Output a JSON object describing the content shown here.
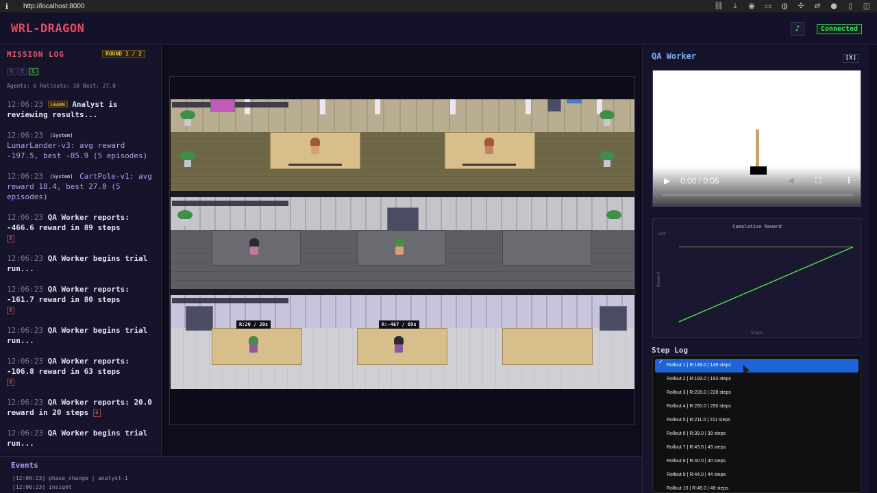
{
  "browser": {
    "url": "http://localhost:8000"
  },
  "header": {
    "title": "WRL-DRAGON",
    "music_icon": "♪",
    "status": "Connected",
    "status_color": "#4be06a"
  },
  "sidebar": {
    "title": "MISSION LOG",
    "round": "ROUND 1 / 2",
    "filters": [
      "G",
      "E",
      "L"
    ],
    "stats": "Agents: 6  Rollouts: 10  Best: 27.0",
    "entries": [
      {
        "time": "12:06:23",
        "tag": "LEARN",
        "text": "Analyst is reviewing results..."
      },
      {
        "time": "12:06:23",
        "tag": "[System]",
        "text": "LunarLander-v3: avg reward -197.5, best -85.9 (5 episodes)"
      },
      {
        "time": "12:06:23",
        "tag": "[System]",
        "text": "CartPole-v1: avg reward 18.4, best 27.0 (5 episodes)"
      },
      {
        "time": "12:06:23",
        "text": "QA Worker reports: -466.6 reward in 89 steps",
        "badge": "D"
      },
      {
        "time": "12:06:23",
        "text": "QA Worker begins trial run..."
      },
      {
        "time": "12:06:23",
        "text": "QA Worker reports: -161.7 reward in 80 steps",
        "badge": "D"
      },
      {
        "time": "12:06:23",
        "text": "QA Worker begins trial run..."
      },
      {
        "time": "12:06:23",
        "text": "QA Worker reports: -106.8 reward in 63 steps",
        "badge": "D"
      },
      {
        "time": "12:06:23",
        "text": "QA Worker reports: 20.0 reward in 20 steps",
        "badge": "D"
      },
      {
        "time": "12:06:23",
        "text": "QA Worker begins trial run..."
      }
    ]
  },
  "events": {
    "title": "Events",
    "lines": [
      "[12:06:23] phase_change | analyst-1",
      "[12:06:23] insight"
    ]
  },
  "game": {
    "badges": [
      "R:20 / 20s",
      "R:-467 / 89s"
    ]
  },
  "panel": {
    "title": "QA Worker",
    "close_label": "[X]",
    "video": {
      "time": "0:00 / 0:05",
      "progress": 0
    },
    "steplog_title": "Step Log",
    "rollouts": [
      "Rollout 1 | R:149.0 | 149 steps",
      "Rollout 2 | R:193.0 | 193 steps",
      "Rollout 3 | R:228.0 | 228 steps",
      "Rollout 4 | R:250.0 | 250 steps",
      "Rollout 5 | R:211.0 | 211 steps",
      "Rollout 6 | R:39.0 | 39 steps",
      "Rollout 7 | R:43.0 | 43 steps",
      "Rollout 8 | R:40.0 | 40 steps",
      "Rollout 9 | R:44.0 | 44 steps",
      "Rollout 10 | R:46.0 | 46 steps"
    ],
    "selected_rollout": 0
  },
  "chart_data": {
    "type": "line",
    "title": "Cumulative Reward",
    "xlabel": "Steps",
    "ylabel": "Reward",
    "y_tick": "149",
    "series": [
      {
        "x": [
          0,
          149
        ],
        "values": [
          0,
          149
        ]
      }
    ],
    "reference_line": 149,
    "line_color": "#4cd94a",
    "reference_color": "#8a7d4a"
  }
}
